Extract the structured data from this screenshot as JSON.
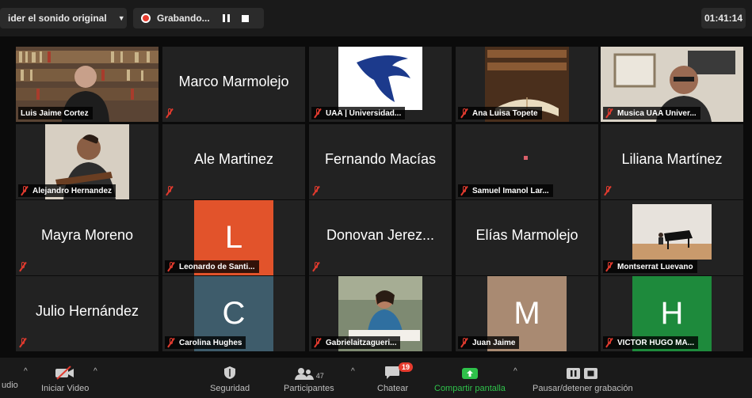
{
  "top_bar": {
    "original_sound": "ider el sonido original",
    "recording_label": "Grabando...",
    "timer": "01:41:14"
  },
  "tiles": [
    {
      "label": "Luis Jaime Cortez",
      "big_name": "",
      "avatar_letter": ""
    },
    {
      "label": "",
      "big_name": "Marco Marmolejo",
      "avatar_letter": ""
    },
    {
      "label": "UAA | Universidad...",
      "big_name": "",
      "avatar_letter": ""
    },
    {
      "label": "Ana Luisa Topete",
      "big_name": "",
      "avatar_letter": ""
    },
    {
      "label": "Musica UAA Univer...",
      "big_name": "",
      "avatar_letter": ""
    },
    {
      "label": "Alejandro Hernandez",
      "big_name": "",
      "avatar_letter": ""
    },
    {
      "label": "",
      "big_name": "Ale Martinez",
      "avatar_letter": ""
    },
    {
      "label": "",
      "big_name": "Fernando Macías",
      "avatar_letter": ""
    },
    {
      "label": "Samuel Imanol Lar...",
      "big_name": "",
      "avatar_letter": ""
    },
    {
      "label": "",
      "big_name": "Liliana Martínez",
      "avatar_letter": ""
    },
    {
      "label": "",
      "big_name": "Mayra Moreno",
      "avatar_letter": ""
    },
    {
      "label": "Leonardo de Santi...",
      "big_name": "",
      "avatar_letter": "L"
    },
    {
      "label": "",
      "big_name": "Donovan  Jerez...",
      "avatar_letter": ""
    },
    {
      "label": "",
      "big_name": "Elías Marmolejo",
      "avatar_letter": ""
    },
    {
      "label": "Montserrat Luevano",
      "big_name": "",
      "avatar_letter": ""
    },
    {
      "label": "",
      "big_name": "Julio Hernández",
      "avatar_letter": ""
    },
    {
      "label": "Carolina Hughes",
      "big_name": "",
      "avatar_letter": "C"
    },
    {
      "label": "Gabrielaitzagueri...",
      "big_name": "",
      "avatar_letter": ""
    },
    {
      "label": "Juan Jaime",
      "big_name": "",
      "avatar_letter": "M"
    },
    {
      "label": "VICTOR HUGO MA...",
      "big_name": "",
      "avatar_letter": "H"
    }
  ],
  "toolbar": {
    "audio": "udio",
    "start_video": "Iniciar Video",
    "security": "Seguridad",
    "participants": "Participantes",
    "participants_count": "47",
    "chat": "Chatear",
    "chat_badge": "19",
    "share_screen": "Compartir pantalla",
    "pause_recording": "Pausar/detener grabación"
  },
  "colors": {
    "active_speaker_border": "#d8e25a",
    "recording_red": "#e63b2e",
    "share_green": "#2fc24b",
    "avatar_L": "#e2532b",
    "avatar_C": "#3e5c6b",
    "avatar_M": "#a98a72",
    "avatar_H": "#1e8a3c"
  }
}
